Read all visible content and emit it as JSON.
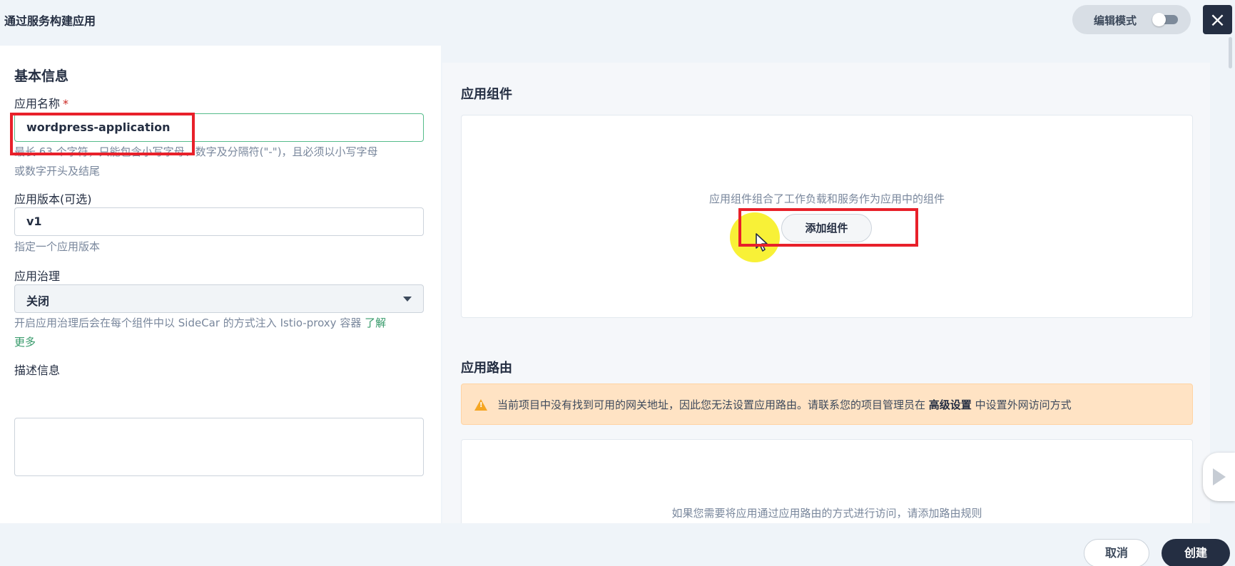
{
  "header": {
    "title": "通过服务构建应用",
    "edit_mode_label": "编辑模式",
    "close_icon": "close-icon"
  },
  "basic": {
    "section_title": "基本信息",
    "name_label": "应用名称",
    "name_required_mark": "*",
    "name_value": "wordpress-application",
    "name_hint_line1": "最长 63 个字符，只能包含小写字母、数字及分隔符(\"-\")，且必须以小写字母",
    "name_hint_line2": "或数字开头及结尾",
    "version_label": "应用版本(可选)",
    "version_value": "v1",
    "version_hint": "指定一个应用版本",
    "governance_label": "应用治理",
    "governance_value": "关闭",
    "governance_hint_line1": "开启应用治理后会在每个组件中以 SideCar 的方式注入 Istio-proxy 容器",
    "governance_link_part1": "了解",
    "governance_link_part2": "更多",
    "description_label": "描述信息",
    "description_value": ""
  },
  "components": {
    "section_title": "应用组件",
    "empty_text": "应用组件组合了工作负载和服务作为应用中的组件",
    "add_button_label": "添加组件"
  },
  "routes": {
    "section_title": "应用路由",
    "warning_prefix": "当前项目中没有找到可用的网关地址，因此您无法设置应用路由。请联系您的项目管理员在",
    "warning_bold": "高级设置",
    "warning_suffix": "中设置外网访问方式",
    "empty_text": "如果您需要将应用通过应用路由的方式进行访问，请添加路由规则"
  },
  "footer": {
    "cancel_label": "取消",
    "create_label": "创建"
  },
  "colors": {
    "primary_dark": "#242e42",
    "highlight_red": "#e8202a",
    "warning_bg": "#ffe3c4",
    "link_green": "#369a6a"
  }
}
